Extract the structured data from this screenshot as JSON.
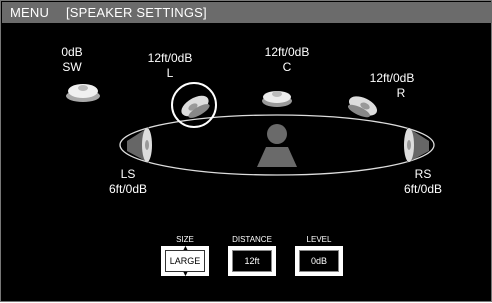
{
  "title": {
    "menu": "MENU",
    "section": "[SPEAKER SETTINGS]"
  },
  "speakers": {
    "sw": {
      "level": "0dB",
      "name": "SW"
    },
    "l": {
      "value": "12ft/0dB",
      "name": "L"
    },
    "c": {
      "value": "12ft/0dB",
      "name": "C"
    },
    "r": {
      "value": "12ft/0dB",
      "name": "R"
    },
    "ls": {
      "name": "LS",
      "value": "6ft/0dB"
    },
    "rs": {
      "name": "RS",
      "value": "6ft/0dB"
    }
  },
  "controls": {
    "size": {
      "label": "SIZE",
      "value": "LARGE"
    },
    "distance": {
      "label": "DISTANCE",
      "value": "12ft"
    },
    "level": {
      "label": "LEVEL",
      "value": "0dB"
    }
  },
  "selected_speaker": "L"
}
